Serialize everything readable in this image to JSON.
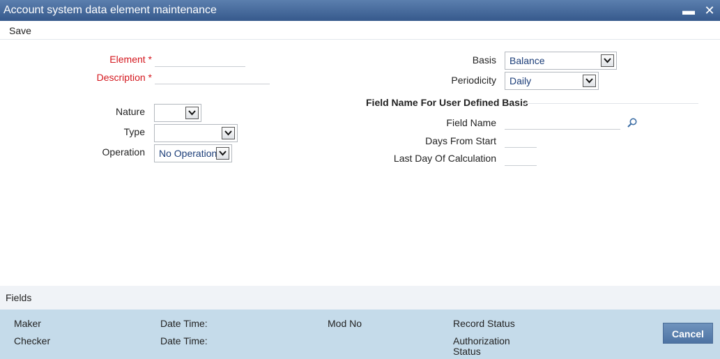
{
  "window": {
    "title": "Account system data element maintenance",
    "minimize_glyph": "▬",
    "close_glyph": "✕"
  },
  "toolbar": {
    "save_label": "Save"
  },
  "form_left": {
    "element_label": "Element",
    "element_required": "*",
    "element_value": "",
    "description_label": "Description",
    "description_required": "*",
    "description_value": "",
    "nature_label": "Nature",
    "nature_value": "",
    "type_label": "Type",
    "type_value": "",
    "operation_label": "Operation",
    "operation_value": "No Operation"
  },
  "form_right": {
    "basis_label": "Basis",
    "basis_value": "Balance",
    "periodicity_label": "Periodicity",
    "periodicity_value": "Daily",
    "section_title": "Field Name For User Defined Basis",
    "field_name_label": "Field Name",
    "field_name_value": "",
    "days_from_start_label": "Days From Start",
    "days_from_start_value": "",
    "last_day_label": "Last Day Of Calculation",
    "last_day_value": ""
  },
  "fields_bar": {
    "label": "Fields"
  },
  "footer": {
    "maker_label": "Maker",
    "checker_label": "Checker",
    "date_time_label_1": "Date Time:",
    "date_time_label_2": "Date Time:",
    "mod_no_label": "Mod No",
    "record_status_label": "Record Status",
    "authorization_label_line1": "Authorization",
    "authorization_label_line2": "Status",
    "cancel_label": "Cancel"
  },
  "icons": {
    "search": "search-icon",
    "dropdown": "chevron-down-icon"
  },
  "colors": {
    "title_bar": "#36598c",
    "required": "#d4171e",
    "select_value": "#1b3d78",
    "footer_bg": "#c5dbea",
    "cancel_button": "#5b80ae"
  }
}
